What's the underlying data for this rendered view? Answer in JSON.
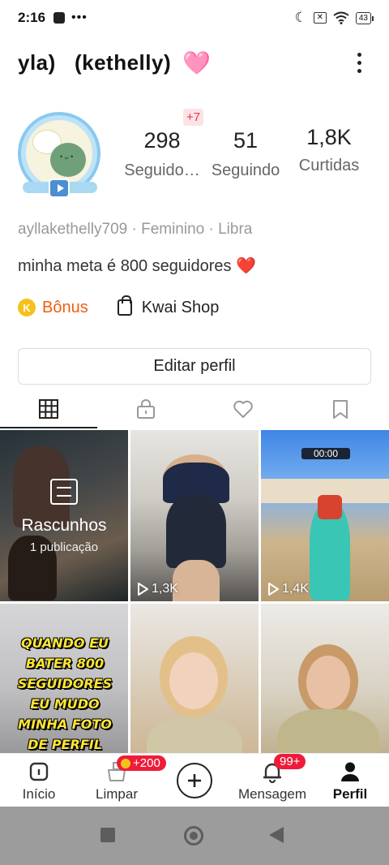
{
  "status_bar": {
    "time": "2:16",
    "battery": "43"
  },
  "header": {
    "title": "yla)   (kethelly)",
    "heart": "🩷"
  },
  "stats": {
    "new_followers_badge": "+7",
    "followers": {
      "value": "298",
      "label": "Seguido…"
    },
    "following": {
      "value": "51",
      "label": "Seguindo"
    },
    "likes": {
      "value": "1,8K",
      "label": "Curtidas"
    }
  },
  "profile": {
    "meta": "ayllakethelly709 · Feminino · Libra",
    "bio": "minha meta é 800 seguidores",
    "bio_emoji": "❤️"
  },
  "links": {
    "bonus_coin": "K",
    "bonus": "Bônus",
    "shop": "Kwai Shop"
  },
  "edit_button": "Editar perfil",
  "tabs": [
    "grid-icon",
    "lock-icon",
    "heart-icon",
    "bookmark-icon"
  ],
  "grid": {
    "drafts": {
      "title": "Rascunhos",
      "count": "1 publicação"
    },
    "videos": [
      {
        "views": "1,3K"
      },
      {
        "views": "1,4K",
        "hud_timer": "00:00"
      },
      {
        "caption": "QUANDO EU BATER 800 SEGUIDORES EU MUDO MINHA FOTO DE PERFIL"
      }
    ]
  },
  "bottom_nav": {
    "home": "Início",
    "clean": "Limpar",
    "clean_badge": "+200",
    "messages": "Mensagem",
    "messages_badge": "99+",
    "profile": "Perfil"
  },
  "colors": {
    "accent": "#f25d0e",
    "badge": "#ee1c3a",
    "coin": "#f5c21b"
  }
}
